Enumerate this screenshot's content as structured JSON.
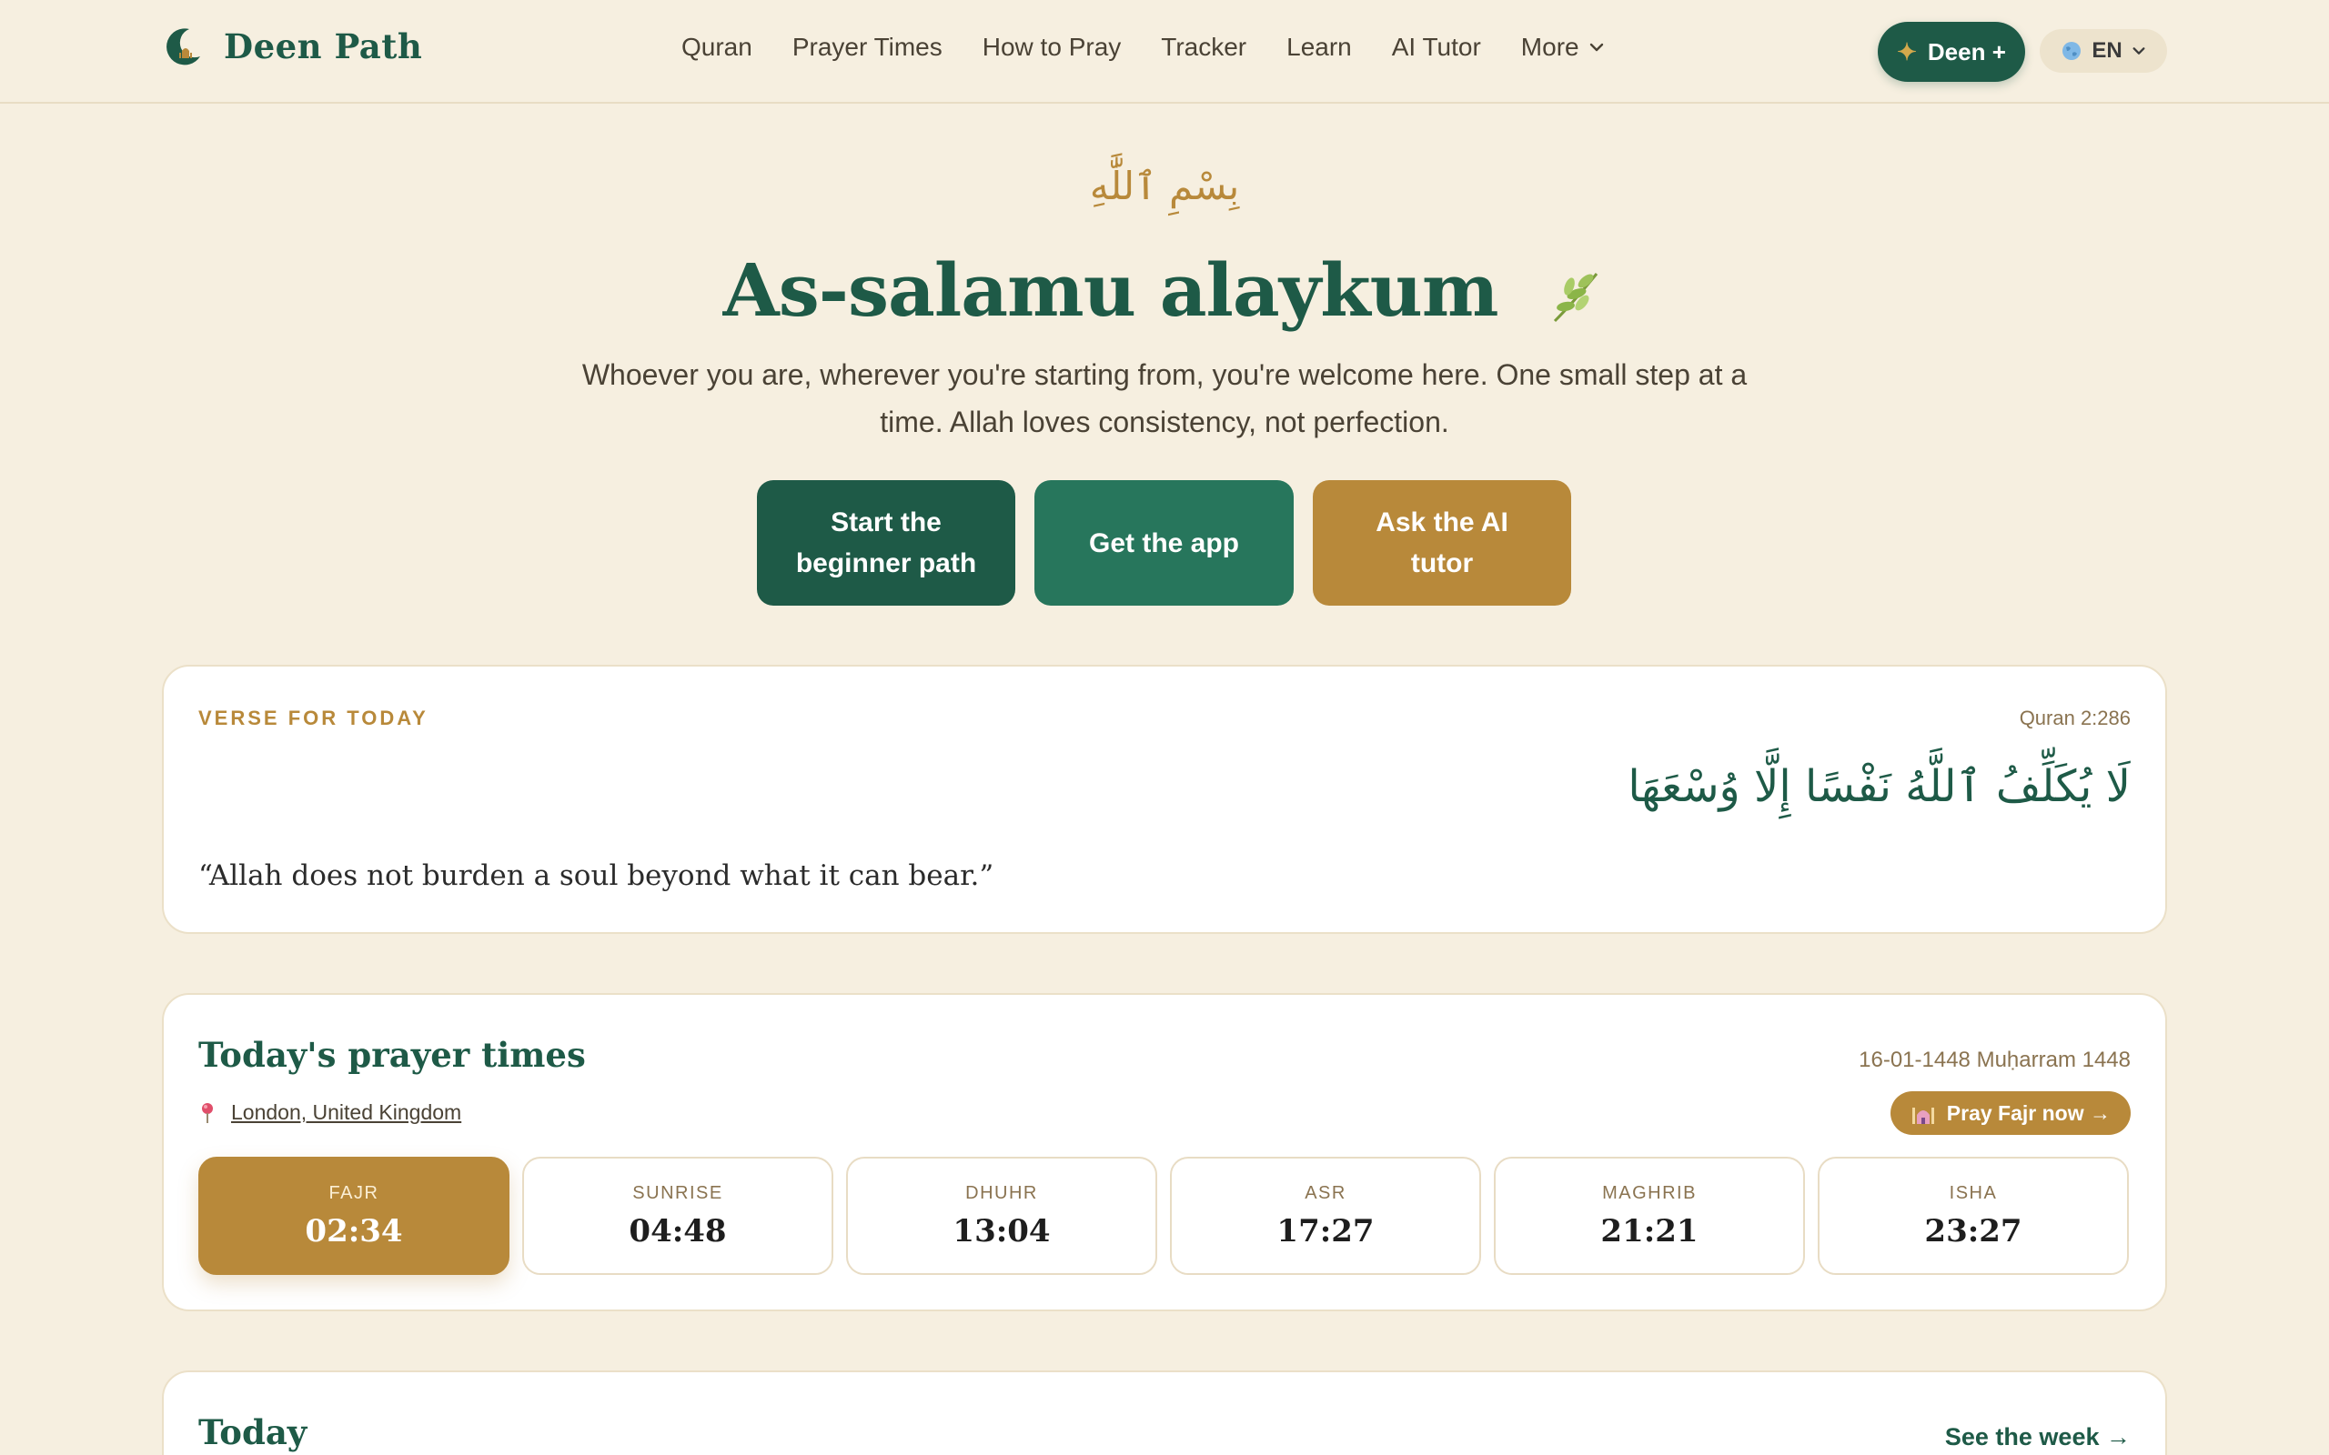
{
  "brand": {
    "name": "Deen Path"
  },
  "nav": {
    "items": [
      "Quran",
      "Prayer Times",
      "How to Pray",
      "Tracker",
      "Learn",
      "AI Tutor"
    ],
    "more_label": "More"
  },
  "header": {
    "deen_plus_label": "Deen +",
    "language_label": "EN"
  },
  "hero": {
    "bismillah": "بِسْمِ ٱللَّٰهِ",
    "title": "As-salamu alaykum",
    "subtitle": "Whoever you are, wherever you're starting from, you're welcome here. One small step at a time. Allah loves consistency, not perfection.",
    "cta_start": "Start the beginner path",
    "cta_app": "Get the app",
    "cta_tutor": "Ask the AI tutor"
  },
  "verse": {
    "label": "VERSE FOR TODAY",
    "reference": "Quran 2:286",
    "arabic": "لَا يُكَلِّفُ ٱللَّهُ نَفْسًا إِلَّا وُسْعَهَا",
    "english": "“Allah does not burden a soul beyond what it can bear.”"
  },
  "prayer": {
    "title": "Today's prayer times",
    "date": "16-01-1448 Muḥarram 1448",
    "location": "London, United Kingdom",
    "pray_now_label": "Pray Fajr now →",
    "times": [
      {
        "name": "FAJR",
        "time": "02:34",
        "active": true
      },
      {
        "name": "SUNRISE",
        "time": "04:48",
        "active": false
      },
      {
        "name": "DHUHR",
        "time": "13:04",
        "active": false
      },
      {
        "name": "ASR",
        "time": "17:27",
        "active": false
      },
      {
        "name": "MAGHRIB",
        "time": "21:21",
        "active": false
      },
      {
        "name": "ISHA",
        "time": "23:27",
        "active": false
      }
    ]
  },
  "today": {
    "title": "Today",
    "see_week_label": "See the week →"
  },
  "colors": {
    "primary": "#1e5a47",
    "accent": "#b8893a",
    "background": "#f6efe0"
  }
}
